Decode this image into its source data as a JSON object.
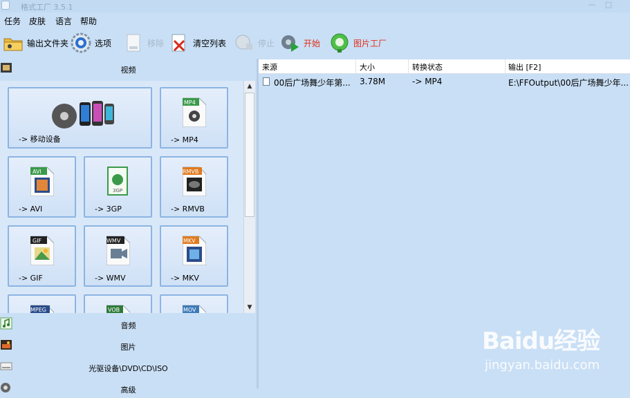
{
  "window": {
    "title": "格式工厂 3.5.1"
  },
  "menu": [
    "任务",
    "皮肤",
    "语言",
    "帮助"
  ],
  "toolbar": {
    "output_folder": "输出文件夹",
    "options": "选项",
    "remove": "移除",
    "clear_list": "清空列表",
    "stop": "停止",
    "start": "开始",
    "picture_factory": "图片工厂"
  },
  "categories": {
    "video": "视频",
    "audio": "音频",
    "picture": "图片",
    "disc": "光驱设备\\DVD\\CD\\ISO",
    "advanced": "高级"
  },
  "tiles": [
    {
      "label": "-> 移动设备",
      "icon": "mobile-devices-icon"
    },
    {
      "label": "-> MP4",
      "badge": "MP4",
      "icon": "mp4-file-icon",
      "color": "#3a9a4a"
    },
    {
      "label": "-> AVI",
      "badge": "AVI",
      "icon": "avi-file-icon",
      "color": "#3a9a4a"
    },
    {
      "label": "-> 3GP",
      "badge": "3GP",
      "icon": "3gp-file-icon",
      "color": "#3a9a4a"
    },
    {
      "label": "-> RMVB",
      "badge": "RMVB",
      "icon": "rmvb-file-icon",
      "color": "#e07a1f"
    },
    {
      "label": "-> GIF",
      "badge": "GIF",
      "icon": "gif-file-icon",
      "color": "#222222"
    },
    {
      "label": "-> WMV",
      "badge": "WMV",
      "icon": "wmv-file-icon",
      "color": "#222222"
    },
    {
      "label": "-> MKV",
      "badge": "MKV",
      "icon": "mkv-file-icon",
      "color": "#e07a1f"
    },
    {
      "label": "",
      "badge": "MPEG",
      "icon": "mpeg-file-icon",
      "color": "#2b4c8a"
    },
    {
      "label": "",
      "badge": "VOB",
      "icon": "vob-file-icon",
      "color": "#2f7a3a"
    },
    {
      "label": "",
      "badge": "MOV",
      "icon": "mov-file-icon",
      "color": "#3d7ab8"
    }
  ],
  "table": {
    "columns": [
      "来源",
      "大小",
      "转换状态",
      "输出 [F2]"
    ],
    "rows": [
      {
        "source": "00后广场舞少年第...",
        "size": "3.78M",
        "status": "-> MP4",
        "output": "E:\\FFOutput\\00后广场舞少年..."
      }
    ]
  },
  "watermark": {
    "brand": "Baidu经验",
    "url": "jingyan.baidu.com"
  }
}
